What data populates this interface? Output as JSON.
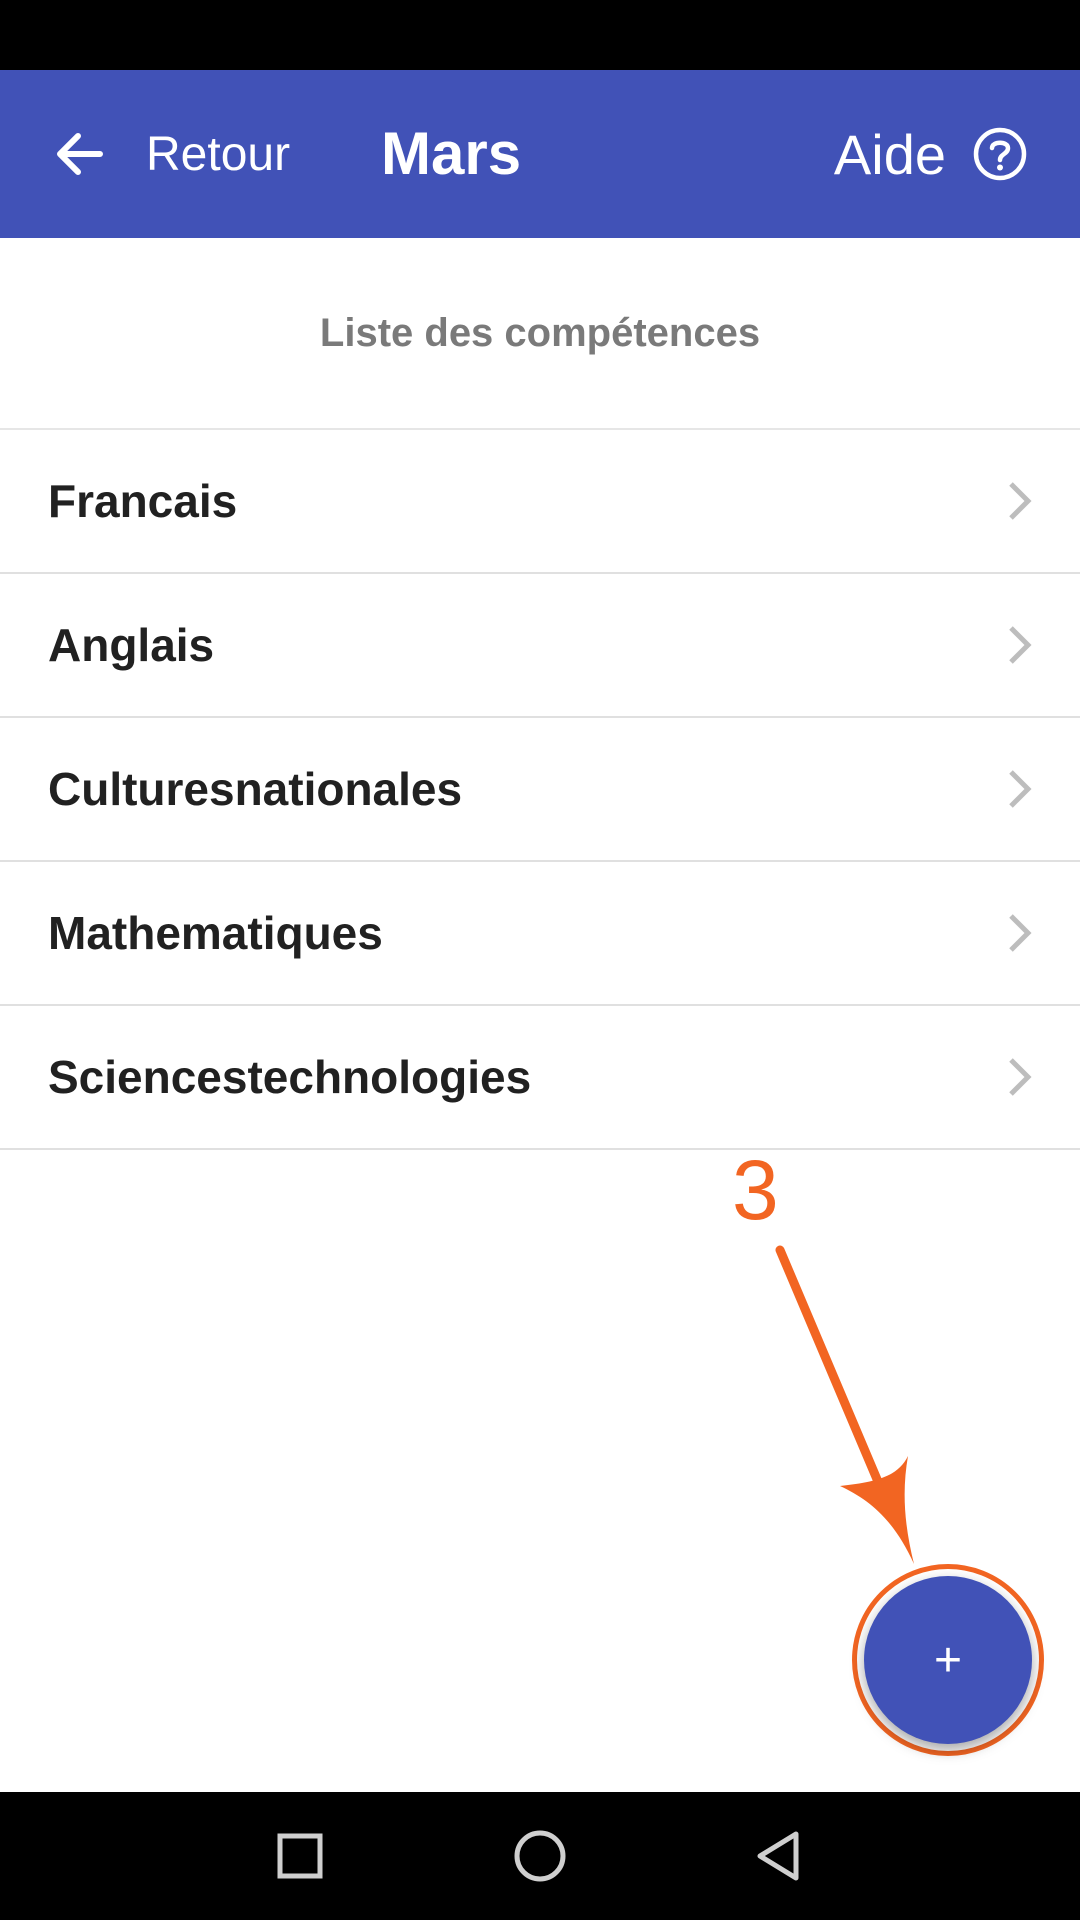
{
  "app_bar": {
    "back_label": "Retour",
    "title": "Mars",
    "help_label": "Aide",
    "background_color": "#4152B7"
  },
  "section": {
    "title": "Liste des compétences"
  },
  "skills": [
    {
      "label": "Francais"
    },
    {
      "label": "Anglais"
    },
    {
      "label": "Culturesnationales"
    },
    {
      "label": "Mathematiques"
    },
    {
      "label": "Sciencestechnologies"
    }
  ],
  "annotation": {
    "step_number": "3",
    "color": "#F26522"
  },
  "fab": {
    "label": "+"
  },
  "icons": [
    "arrow-left-icon",
    "help-circle-icon",
    "chevron-right-icon",
    "plus-icon",
    "square-icon",
    "circle-icon",
    "triangle-back-icon"
  ]
}
